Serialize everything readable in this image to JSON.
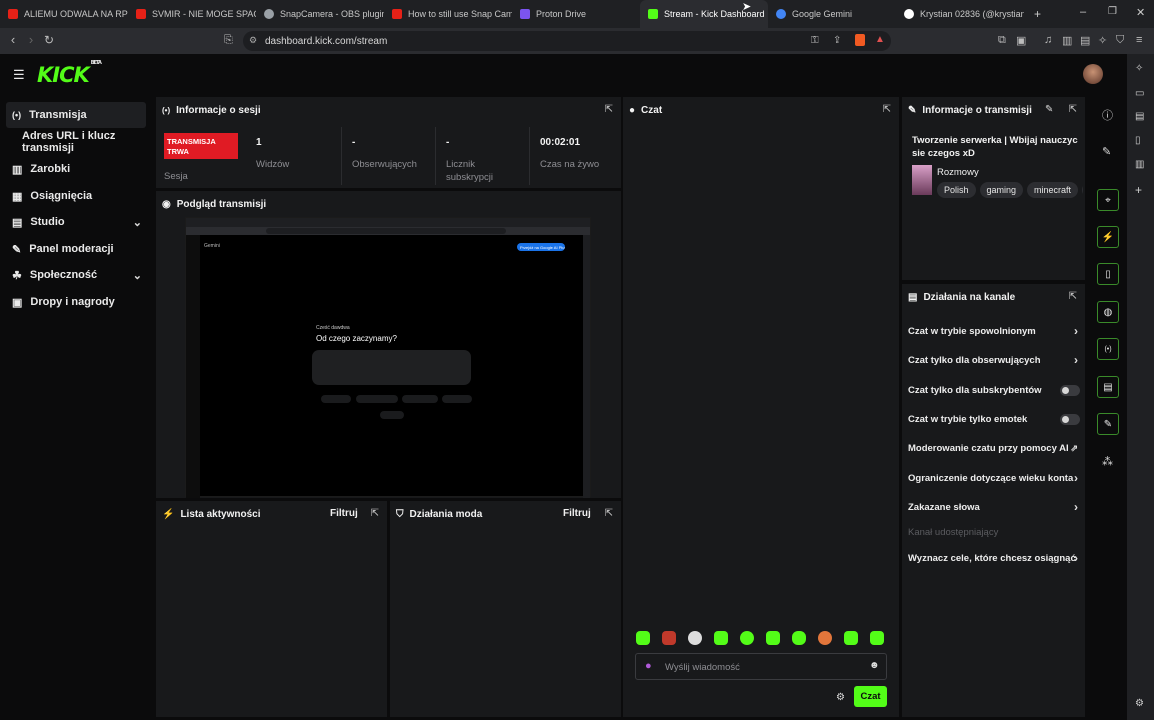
{
  "browser": {
    "tabs": [
      {
        "label": "ALIEMU ODWALA NA RP | GTA",
        "color": "#e62117",
        "active": false
      },
      {
        "label": "SVMIR - NIE MOGE SPAĆ",
        "color": "#e62117",
        "active": false
      },
      {
        "label": "SnapCamera - OBS plugin / Ca",
        "color": "#9aa0a6",
        "active": false
      },
      {
        "label": "How to still use Snap Came",
        "color": "#e62117",
        "active": false
      },
      {
        "label": "Proton Drive",
        "color": "#7b54f0",
        "active": false
      },
      {
        "label": "Stream - Kick Dashboard",
        "color": "#53fc18",
        "active": true
      },
      {
        "label": "Google Gemini",
        "color": "#4285f4",
        "active": false
      },
      {
        "label": "Krystian 02836 (@krystian795",
        "color": "#ffffff",
        "active": false
      }
    ],
    "url": "dashboard.kick.com/stream"
  },
  "app": {
    "logo": "KICK",
    "logo_badge": "BETA"
  },
  "sidebar": {
    "items": [
      {
        "label": "Transmisja",
        "icon": "broadcast-icon"
      },
      {
        "label": "Adres URL i klucz transmisji",
        "icon": ""
      },
      {
        "label": "Zarobki",
        "icon": "chart-icon"
      },
      {
        "label": "Osiągnięcia",
        "icon": "trophy-icon"
      },
      {
        "label": "Studio",
        "icon": "studio-icon"
      },
      {
        "label": "Panel moderacji",
        "icon": "wrench-icon"
      },
      {
        "label": "Społeczność",
        "icon": "community-icon"
      },
      {
        "label": "Dropy i nagrody",
        "icon": "gift-icon"
      }
    ]
  },
  "session": {
    "title": "Informacje o sesji",
    "live_badge": "TRANSMISJA TRWA",
    "badge_color": "#e01b24",
    "session_label": "Sesja",
    "stats": [
      {
        "value": "1",
        "label": "Widzów"
      },
      {
        "value": "-",
        "label": "Obserwujących"
      },
      {
        "value": "-",
        "label": "Licznik subskrypcji"
      },
      {
        "value": "00:02:01",
        "label": "Czas na żywo"
      }
    ]
  },
  "preview": {
    "title": "Podgląd transmisji",
    "inner_tab": "Gemini",
    "greeting": "Cześć dawdwa",
    "question": "Od czego zaczynamy?",
    "upgrade": "Przejdź na Google AI Plus"
  },
  "activity": {
    "title": "Lista aktywności",
    "filter": "Filtruj"
  },
  "mod_actions": {
    "title": "Działania moda",
    "filter": "Filtruj"
  },
  "chat": {
    "title": "Czat",
    "input_placeholder": "Wyślij wiadomość",
    "send_label": "Czat"
  },
  "stream_info": {
    "title": "Informacje o transmisji",
    "stream_title": "Tworzenie serwerka | Wbijaj nauczyc sie czegos xD",
    "category": "Rozmowy",
    "tags": [
      "Polish",
      "gaming",
      "minecraft"
    ]
  },
  "channel_actions": {
    "title": "Działania na kanale",
    "rows": [
      {
        "label": "Czat w trybie spowolnionym",
        "control": "arrow"
      },
      {
        "label": "Czat tylko dla obserwujących",
        "control": "arrow"
      },
      {
        "label": "Czat tylko dla subskrybentów",
        "control": "toggle"
      },
      {
        "label": "Czat w trybie tylko emotek",
        "control": "toggle"
      },
      {
        "label": "Moderowanie czatu przy pomocy AI",
        "control": "external"
      },
      {
        "label": "Ograniczenie dotyczące wieku konta",
        "control": "arrow"
      },
      {
        "label": "Zakazane słowa",
        "control": "arrow"
      },
      {
        "label": "Kanał udostępniający",
        "control": "disabled"
      },
      {
        "label": "Wyznacz cele, które chcesz osiągnąć",
        "control": "arrow"
      }
    ]
  },
  "colors": {
    "accent": "#53fc18",
    "live": "#e01b24"
  }
}
